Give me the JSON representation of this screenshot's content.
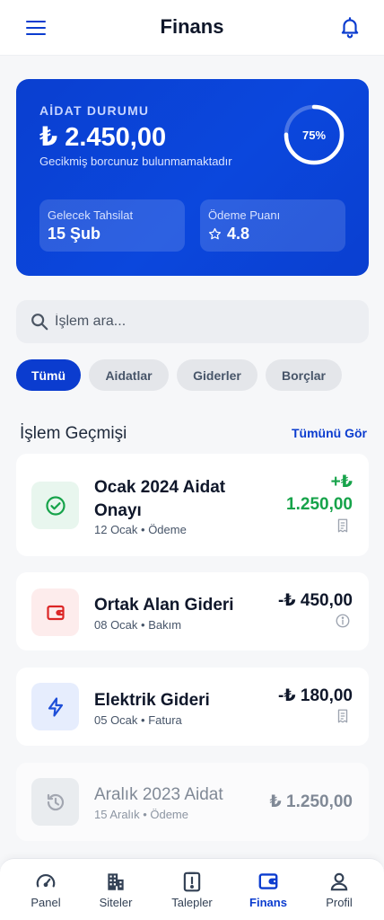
{
  "header": {
    "title": "Finans"
  },
  "hero": {
    "label": "AİDAT DURUMU",
    "amount": "₺ 2.450,00",
    "subtitle": "Gecikmiş borcunuz bulunmamaktadır",
    "progress_percent": 75,
    "progress_label": "75%",
    "stats": [
      {
        "label": "Gelecek Tahsilat",
        "value": "15 Şub"
      },
      {
        "label": "Ödeme Puanı",
        "value": "4.8",
        "icon": "star-icon"
      }
    ],
    "accent_color": "#0b3ccf"
  },
  "search": {
    "placeholder": "İşlem ara..."
  },
  "filters": [
    {
      "label": "Tümü",
      "active": true
    },
    {
      "label": "Aidatlar",
      "active": false
    },
    {
      "label": "Giderler",
      "active": false
    },
    {
      "label": "Borçlar",
      "active": false
    }
  ],
  "history": {
    "title": "İşlem Geçmişi",
    "see_all": "Tümünü Gör",
    "items": [
      {
        "name": "Ocak 2024 Aidat Onayı",
        "meta": "12 Ocak • Ödeme",
        "amount_line1": "+₺",
        "amount_line2": "1.250,00",
        "icon": "check-circle-icon",
        "status_icon": "receipt-icon",
        "color": "#16a34a"
      },
      {
        "name": "Ortak Alan Gideri",
        "meta": "08 Ocak • Bakım",
        "amount": "-₺ 450,00",
        "icon": "wallet-icon",
        "status_icon": "info-icon",
        "color": "#dc2626"
      },
      {
        "name": "Elektrik Gideri",
        "meta": "05 Ocak • Fatura",
        "amount": "-₺ 180,00",
        "icon": "lightning-icon",
        "status_icon": "receipt-icon",
        "color": "#1d4ed8"
      },
      {
        "name": "Aralık 2023 Aidat",
        "meta": "15 Aralık • Ödeme",
        "amount": "₺ 1.250,00",
        "icon": "history-icon"
      }
    ]
  },
  "nav": [
    {
      "label": "Panel",
      "icon": "gauge-icon",
      "active": false
    },
    {
      "label": "Siteler",
      "icon": "building-icon",
      "active": false
    },
    {
      "label": "Talepler",
      "icon": "alert-clipboard-icon",
      "active": false
    },
    {
      "label": "Finans",
      "icon": "wallet-icon",
      "active": true
    },
    {
      "label": "Profil",
      "icon": "user-icon",
      "active": false
    }
  ]
}
